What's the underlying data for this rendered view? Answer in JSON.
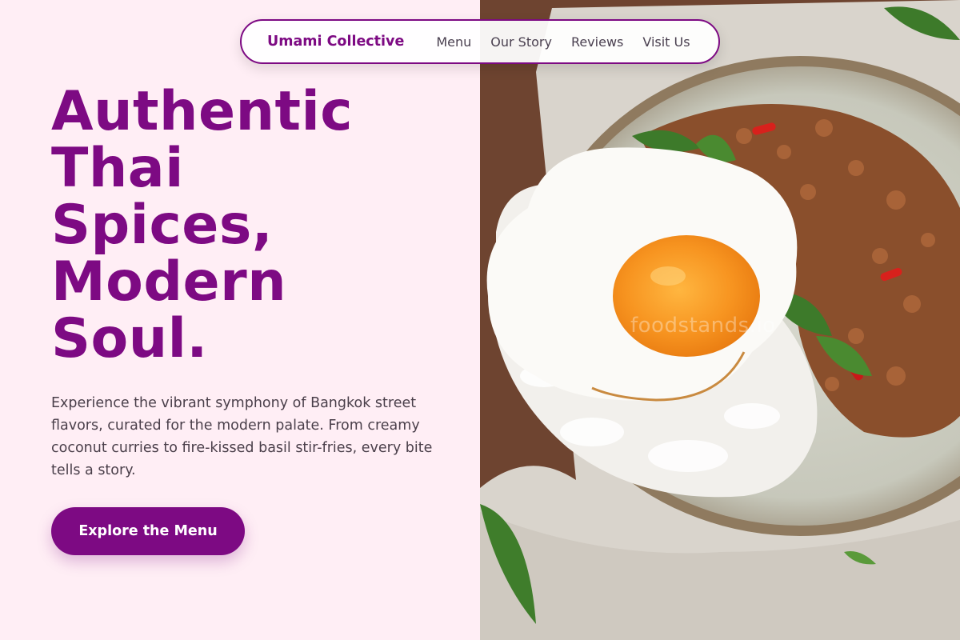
{
  "nav": {
    "brand": "Umami Collective",
    "links": [
      "Menu",
      "Our Story",
      "Reviews",
      "Visit Us"
    ]
  },
  "hero": {
    "headline_lines": [
      "Authentic",
      "Thai",
      "Spices,",
      "Modern",
      "Soul."
    ],
    "body": "Experience the vibrant symphony of Bangkok street flavors, curated for the modern palate. From creamy coconut curries to fire-kissed basil stir-fries, every bite tells a story.",
    "cta_label": "Explore the Menu"
  },
  "photo": {
    "watermark": "foodstands.io"
  },
  "colors": {
    "brand": "#7d0a83",
    "left_bg": "#ffeef5",
    "body_text": "#4a3f4a"
  }
}
